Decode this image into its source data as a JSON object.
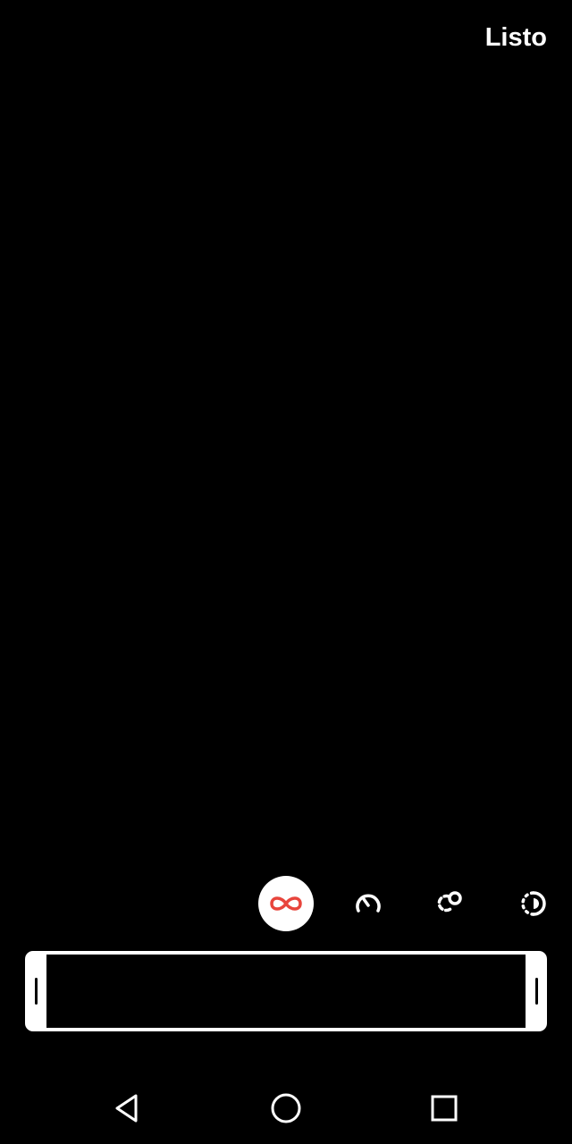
{
  "header": {
    "done_label": "Listo"
  },
  "modes": [
    {
      "id": "boomerang",
      "icon": "infinity-icon",
      "selected": true
    },
    {
      "id": "slowmo",
      "icon": "speedometer-icon",
      "selected": false
    },
    {
      "id": "echo",
      "icon": "echo-circles-icon",
      "selected": false
    },
    {
      "id": "duo",
      "icon": "half-circle-dotted-icon",
      "selected": false
    }
  ],
  "colors": {
    "background": "#000000",
    "foreground": "#ffffff",
    "accent": "#e8453c"
  },
  "navbar": {
    "buttons": [
      "back-icon",
      "home-icon",
      "recents-icon"
    ]
  }
}
